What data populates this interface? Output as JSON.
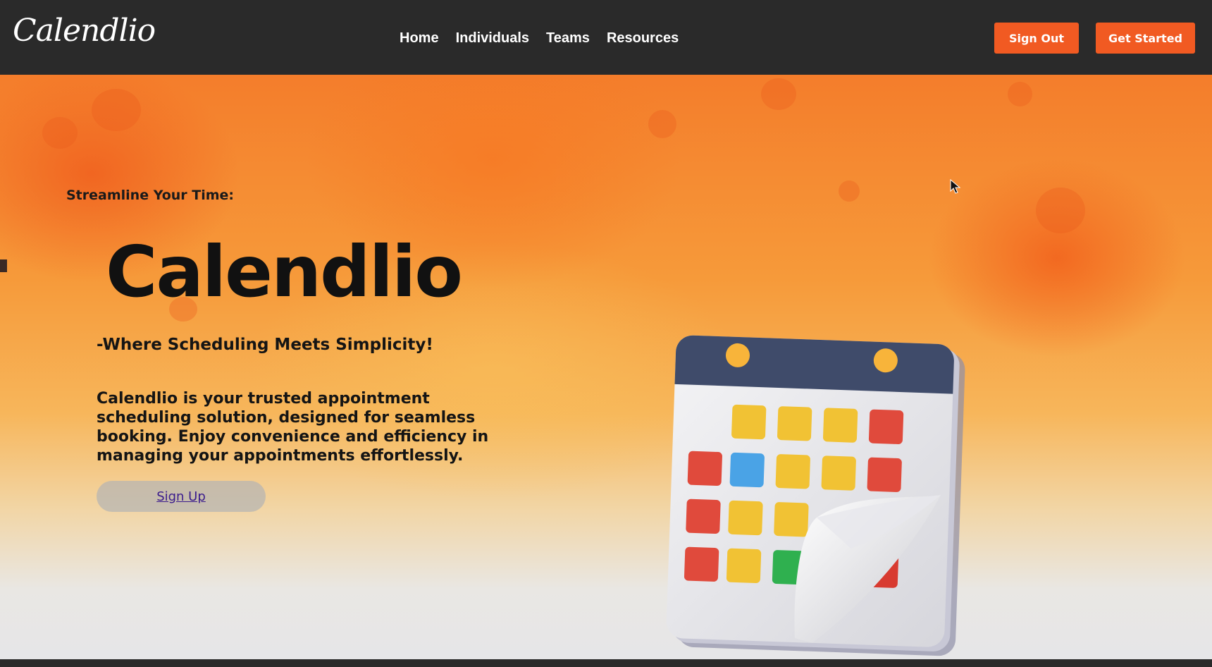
{
  "header": {
    "logo_text": "Calendlio",
    "nav": [
      "Home",
      "Individuals",
      "Teams",
      "Resources"
    ],
    "sign_out_label": "Sign Out",
    "get_started_label": "Get Started"
  },
  "hero": {
    "eyebrow": "Streamline Your Time:",
    "title": "Calendlio",
    "tagline": "-Where Scheduling Meets Simplicity!",
    "description": "Calendlio is your trusted appointment scheduling solution, designed for seamless booking. Enjoy convenience and efficiency in managing your appointments effortlessly.",
    "signup_label": "Sign Up"
  },
  "icons": [
    "calendar-illustration-icon",
    "mouse-cursor-icon"
  ],
  "colors": {
    "header_bg": "#2a2a2a",
    "accent": "#f15a22",
    "hero_orange": "#f47d2b",
    "text_dark": "#141414"
  }
}
